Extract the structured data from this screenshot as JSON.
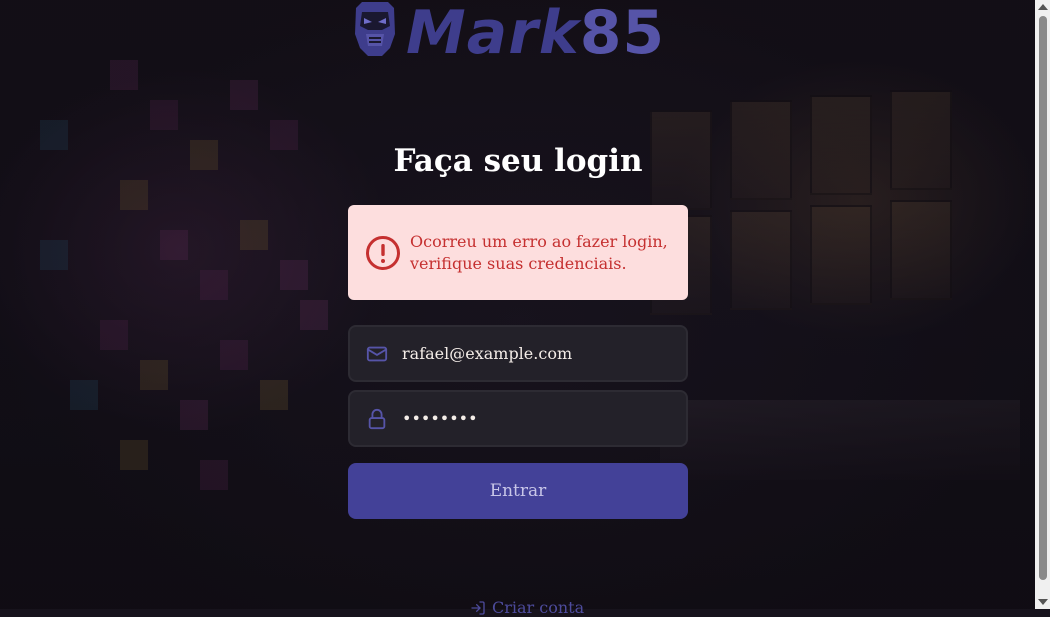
{
  "logo": {
    "text": "Mark",
    "number": "85",
    "icon": "robot-helmet-icon"
  },
  "page": {
    "title": "Faça seu login"
  },
  "alert": {
    "message": "Ocorreu um erro ao fazer login, verifique suas credenciais.",
    "icon": "alert-circle-icon",
    "color": "#c53030",
    "background": "#fddede"
  },
  "form": {
    "email": {
      "value": "rafael@example.com",
      "icon": "mail-icon"
    },
    "password": {
      "value": "••••••••",
      "icon": "lock-icon"
    },
    "submit_label": "Entrar"
  },
  "links": {
    "create_account": "Criar conta",
    "create_account_icon": "log-in-icon"
  },
  "colors": {
    "accent": "#434198",
    "brand": "#3e3d8c"
  }
}
